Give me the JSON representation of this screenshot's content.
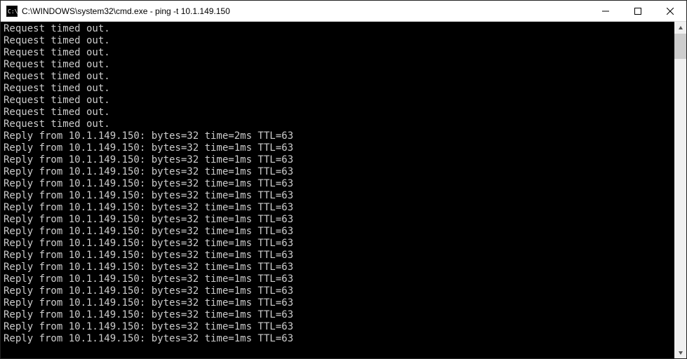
{
  "window": {
    "title": "C:\\WINDOWS\\system32\\cmd.exe - ping  -t 10.1.149.150"
  },
  "console": {
    "lines": [
      "Request timed out.",
      "Request timed out.",
      "Request timed out.",
      "Request timed out.",
      "Request timed out.",
      "Request timed out.",
      "Request timed out.",
      "Request timed out.",
      "Request timed out.",
      "Reply from 10.1.149.150: bytes=32 time=2ms TTL=63",
      "Reply from 10.1.149.150: bytes=32 time=1ms TTL=63",
      "Reply from 10.1.149.150: bytes=32 time=1ms TTL=63",
      "Reply from 10.1.149.150: bytes=32 time=1ms TTL=63",
      "Reply from 10.1.149.150: bytes=32 time=1ms TTL=63",
      "Reply from 10.1.149.150: bytes=32 time=1ms TTL=63",
      "Reply from 10.1.149.150: bytes=32 time=1ms TTL=63",
      "Reply from 10.1.149.150: bytes=32 time=1ms TTL=63",
      "Reply from 10.1.149.150: bytes=32 time=1ms TTL=63",
      "Reply from 10.1.149.150: bytes=32 time=1ms TTL=63",
      "Reply from 10.1.149.150: bytes=32 time=1ms TTL=63",
      "Reply from 10.1.149.150: bytes=32 time=1ms TTL=63",
      "Reply from 10.1.149.150: bytes=32 time=1ms TTL=63",
      "Reply from 10.1.149.150: bytes=32 time=1ms TTL=63",
      "Reply from 10.1.149.150: bytes=32 time=1ms TTL=63",
      "Reply from 10.1.149.150: bytes=32 time=1ms TTL=63",
      "Reply from 10.1.149.150: bytes=32 time=1ms TTL=63",
      "Reply from 10.1.149.150: bytes=32 time=1ms TTL=63"
    ]
  }
}
